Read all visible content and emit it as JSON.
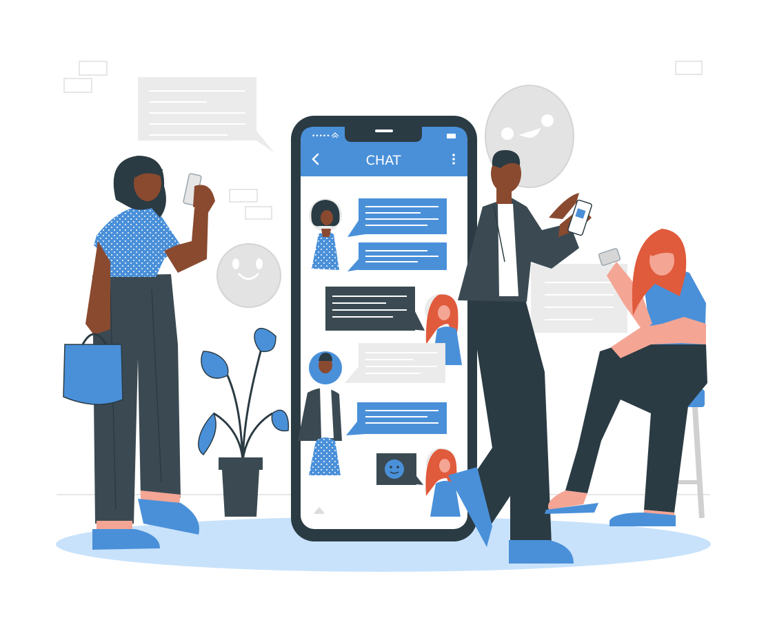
{
  "phone": {
    "title": "CHAT",
    "status_signal": "•••••",
    "icons": [
      "back-chevron-icon",
      "more-vertical-icon",
      "wifi-icon",
      "battery-icon",
      "home-icon"
    ]
  },
  "messages": [
    {
      "sender": "woman-curly-hair",
      "side": "left",
      "style": "blue",
      "lines": 4
    },
    {
      "sender": "woman-curly-hair",
      "side": "left",
      "style": "blue",
      "lines": 3
    },
    {
      "sender": "woman-red-hair",
      "side": "right",
      "style": "dark",
      "lines": 3
    },
    {
      "sender": "man",
      "side": "right",
      "style": "gray",
      "lines": 3
    },
    {
      "sender": "man",
      "side": "left",
      "style": "blue",
      "lines": 3
    },
    {
      "sender": "woman-red-hair",
      "side": "right",
      "style": "dark-emoji",
      "lines": 0
    }
  ],
  "colors": {
    "accent": "#4a90d9",
    "dark": "#3b4a52",
    "skin_dark": "#8a4a2f",
    "skin_light": "#f4a594",
    "hair_red": "#e05a3c",
    "floor": "#c8e2fb",
    "background_shapes": "#ebebeb"
  }
}
